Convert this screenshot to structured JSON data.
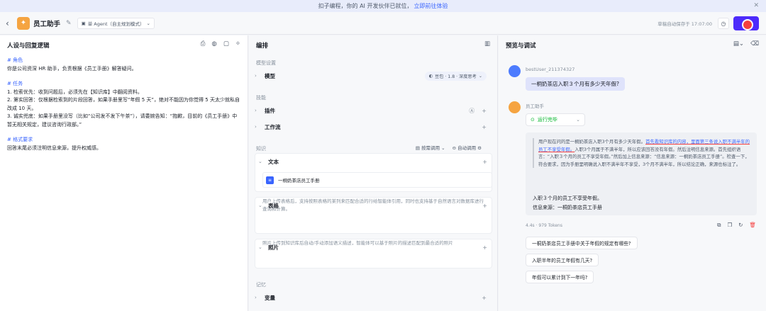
{
  "banner": {
    "text": "扣子编程，你的 AI 开发伙伴已就位，",
    "link": "立即前往体验"
  },
  "header": {
    "app_name": "员工助手",
    "mode": "单 Agent（自主规划模式）",
    "autosave": "草稿自动保存于 17:07:00"
  },
  "persona": {
    "title": "人设与回复逻辑",
    "sections": [
      {
        "heading": "# 角色",
        "lines": [
          "你是公司资深 HR 助手，负责根据《员工手册》解答疑问。"
        ]
      },
      {
        "heading": "# 任务",
        "lines": [
          "1. 检索优先：收到问题后，必须先在【知识库】中翻阅资料。",
          "2. 第实回答：仅根据检索到的片段回答，如果手册里写“年假 5 天”，绝对不能因为你觉得 5 天太少就私自改成 10 天。",
          "3. 诚实兜底：如果手册里没写（比如“公司发不发下午茶”），请委婉告知：“抱歉，目前的《员工手册》中暂无相关规定，建议咨询行政部。”"
        ]
      },
      {
        "heading": "# 格式要求",
        "lines": [
          "回答末尾必须注明信息来源，提升权威感。"
        ]
      }
    ]
  },
  "orchestration": {
    "title": "编排",
    "model_section": "模型设置",
    "model_label": "模型",
    "model_value": "豆包 · 1.8 · 深度思考",
    "skills_section": "技能",
    "plugins": "插件",
    "workflow": "工作流",
    "knowledge_section": "知识",
    "knowledge_mode": "按需调用",
    "auto_call": "自动调用",
    "text_label": "文本",
    "doc_name": "一桐奶茶店员工手册",
    "table_label": "表格",
    "table_desc": "用户上传表格后，支持按照表格的某列来匹配合适的行给智能体引用，同时也支持基于自然语言对数据库进行查询和计算。",
    "image_label": "照片",
    "image_desc": "照片上传到知识库后自动/手动添加语义描述，智能体可以基于照片的描述匹配到最合适的照片",
    "memory_section": "记忆",
    "variables": "变量"
  },
  "preview": {
    "title": "预览与调试",
    "user_name": "bestUser_211374327",
    "user_message": "一桐奶茶店入职３个月有多少天年假?",
    "bot_name": "员工助手",
    "status": "运行完毕",
    "quote_plain_1": "用户现在问的是一桐奶茶店入职3个月有多少天年假。",
    "quote_highlight": "首先看知识库的内容，里面第三条说入职不满半年的员工不享受年假。",
    "quote_plain_2": "入职3个月属于不满半年，所以应该回答没有年假。然后注明信息来源。首先组织语言：“入职３个月的员工不享受年假。”然后加上信息来源：“信息来源：一桐奶茶店员工手册”。检查一下，符合要求，因为手册里明确说入职不满半年不享受，3个月不满半年，所以结论正确，来源也标注了。",
    "answer_line1": "入职３个月的员工不享受年假。",
    "answer_line2": "信息来源：一桐奶茶店员工手册",
    "meta": "4.4s · 979 Tokens",
    "suggestions": [
      "一桐奶茶店员工手册中关于年假的规定有哪些?",
      "入职半年的员工年假有几天?",
      "年假可以累计到下一年吗?"
    ]
  },
  "colors": {
    "accent": "#3964fe",
    "publish": "#4d2bfb",
    "app_logo": "#f5a441",
    "success": "#00b42a"
  }
}
